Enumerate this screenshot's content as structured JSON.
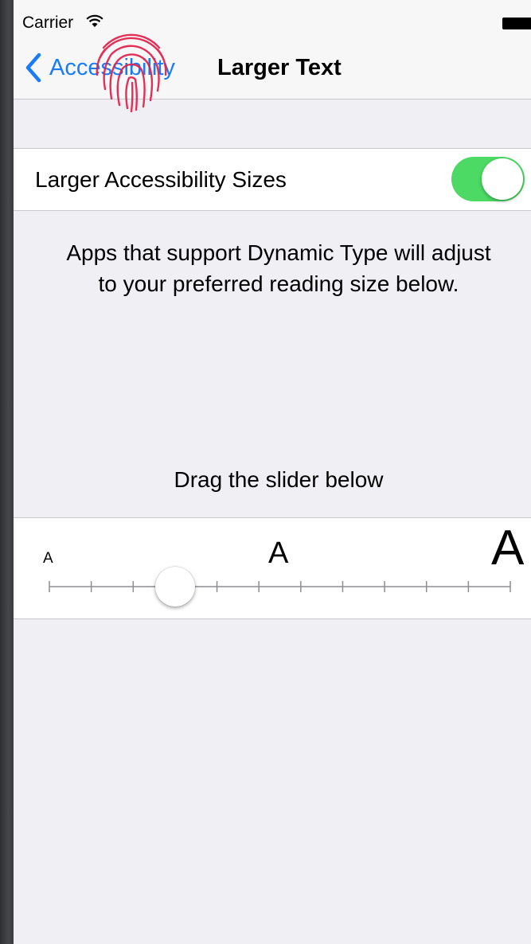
{
  "status_bar": {
    "carrier": "Carrier"
  },
  "nav": {
    "back_label": "Accessibility",
    "title": "Larger Text"
  },
  "toggle": {
    "label": "Larger Accessibility Sizes",
    "on": true
  },
  "description": "Apps that support Dynamic Type will adjust to your preferred reading size below.",
  "slider": {
    "caption": "Drag the slider below",
    "small_label": "A",
    "medium_label": "A",
    "large_label": "A",
    "ticks": 12,
    "value_step": 3
  },
  "colors": {
    "accent": "#1a7cf5",
    "switch_on": "#4cd964",
    "fingerprint": "#e2204a"
  },
  "icons": [
    "wifi-icon",
    "battery-icon",
    "back-chevron-icon",
    "fingerprint-icon"
  ]
}
